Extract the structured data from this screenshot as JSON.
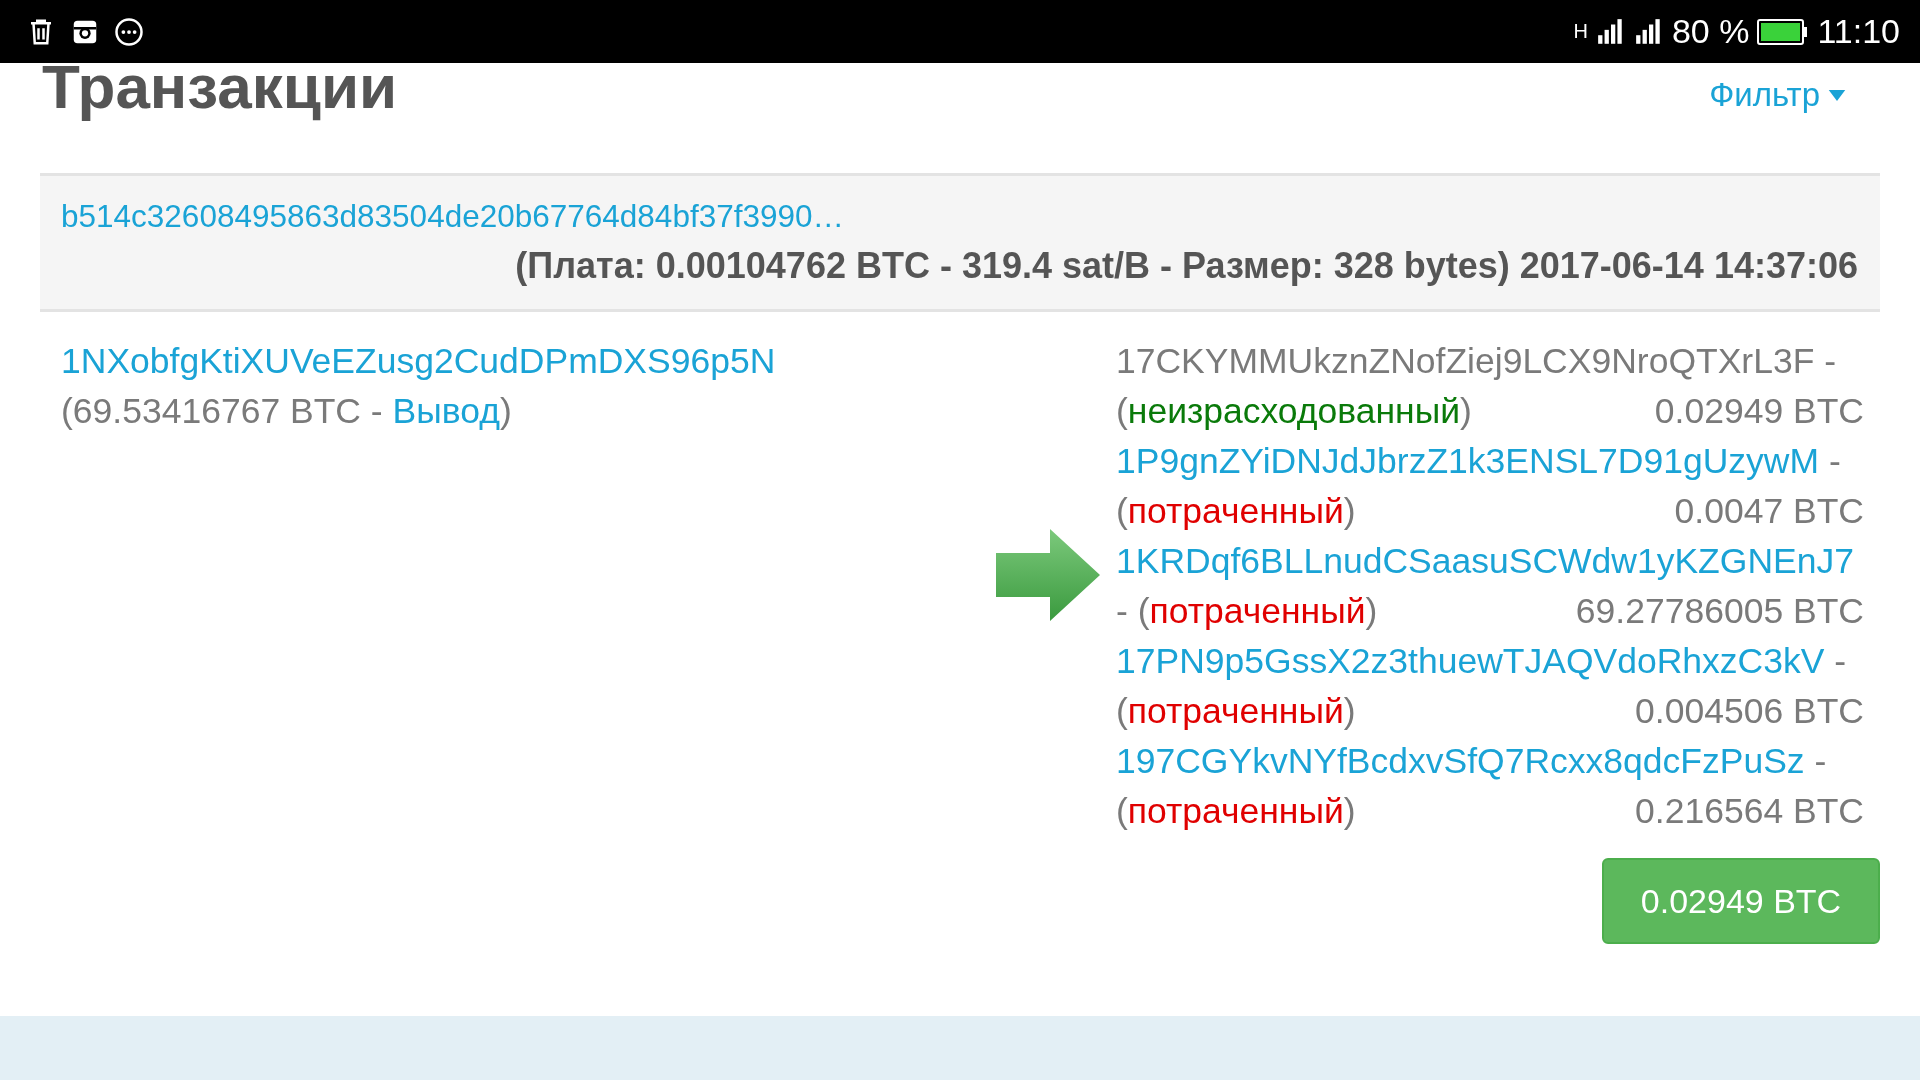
{
  "status_bar": {
    "network": "H",
    "battery_text": "80 %",
    "time": "11:10"
  },
  "header": {
    "title": "Транзакции",
    "filter": "Фильтр"
  },
  "transaction": {
    "hash": "b514c32608495863d83504de20b67764d84bf37f3990…",
    "details": "(Плата: 0.00104762 BTC - 319.4 sat/B - Размер: 328 bytes) 2017-06-14 14:37:06",
    "inputs": [
      {
        "address": "1NXobfgKtiXUVeEZusg2CudDPmDXS96p5N",
        "open": "(",
        "amount": "69.53416767 BTC - ",
        "link": "Вывод",
        "close": ")"
      }
    ],
    "outputs": [
      {
        "address": "17CKYMMUkznZNofZiej9LCX9NroQTXrL3F",
        "linked": false,
        "dash": "-",
        "open": "(",
        "status": "неизрасходованный",
        "spent": false,
        "close": ")",
        "amount": "0.02949 BTC"
      },
      {
        "address": "1P9gnZYiDNJdJbrzZ1k3ENSL7D91gUzywM",
        "linked": true,
        "dash": "-",
        "open": "(",
        "status": "потраченный",
        "spent": true,
        "close": ")",
        "amount": "0.0047 BTC"
      },
      {
        "address": "1KRDqf6BLLnudCSaasuSCWdw1yKZGNEnJ7",
        "linked": true,
        "dash": "-",
        "open": "(",
        "status": "потраченный",
        "spent": true,
        "close": ")",
        "amount": "69.27786005 BTC"
      },
      {
        "address": "17PN9p5GssX2z3thuewTJAQVdoRhxzC3kV",
        "linked": true,
        "dash": "-",
        "open": "(",
        "status": "потраченный",
        "spent": true,
        "close": ")",
        "amount": "0.004506 BTC"
      },
      {
        "address": "197CGYkvNYfBcdxvSfQ7Rcxx8qdcFzPuSz",
        "linked": true,
        "dash": "-",
        "open": "(",
        "status": "потраченный",
        "spent": true,
        "close": ")",
        "amount": "0.216564 BTC"
      }
    ],
    "total": "0.02949 BTC"
  }
}
